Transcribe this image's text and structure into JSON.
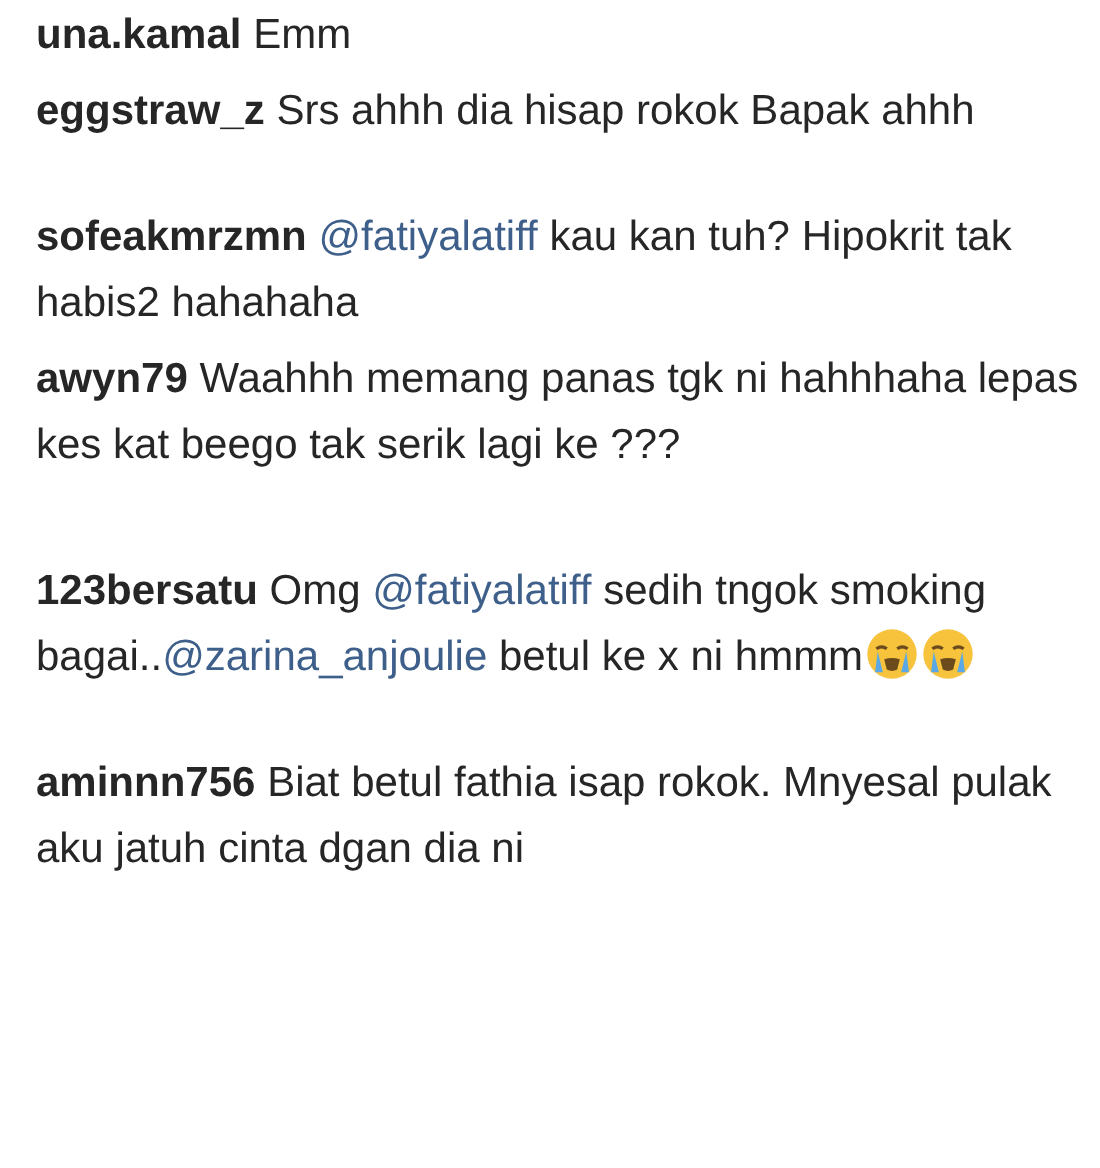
{
  "comments": [
    {
      "username": "una.kamal",
      "parts": [
        {
          "kind": "text",
          "text": "Emm"
        }
      ]
    },
    {
      "username": "eggstraw_z",
      "parts": [
        {
          "kind": "text",
          "text": "Srs ahhh dia hisap rokok Bapak ahhh"
        }
      ]
    },
    {
      "username": "sofeakmrzmn",
      "parts": [
        {
          "kind": "mention",
          "text": "@fatiyalatiff"
        },
        {
          "kind": "text",
          "text": " kau kan tuh? Hipokrit tak habis2 hahahaha"
        }
      ]
    },
    {
      "username": "awyn79",
      "parts": [
        {
          "kind": "text",
          "text": "Waahhh memang panas tgk ni hahhhaha lepas kes kat beego tak serik lagi ke ???"
        }
      ]
    },
    {
      "username": "123bersatu",
      "parts": [
        {
          "kind": "text",
          "text": "Omg "
        },
        {
          "kind": "mention",
          "text": "@fatiyalatiff"
        },
        {
          "kind": "text",
          "text": " sedih tngok smoking bagai.."
        },
        {
          "kind": "mention",
          "text": "@zarina_anjoulie"
        },
        {
          "kind": "text",
          "text": " betul ke x ni hmmm"
        },
        {
          "kind": "emoji"
        },
        {
          "kind": "emoji"
        }
      ]
    },
    {
      "username": "aminnn756",
      "parts": [
        {
          "kind": "text",
          "text": "Biat betul fathia isap rokok. Mnyesal pulak aku jatuh cinta dgan dia ni"
        }
      ]
    }
  ]
}
